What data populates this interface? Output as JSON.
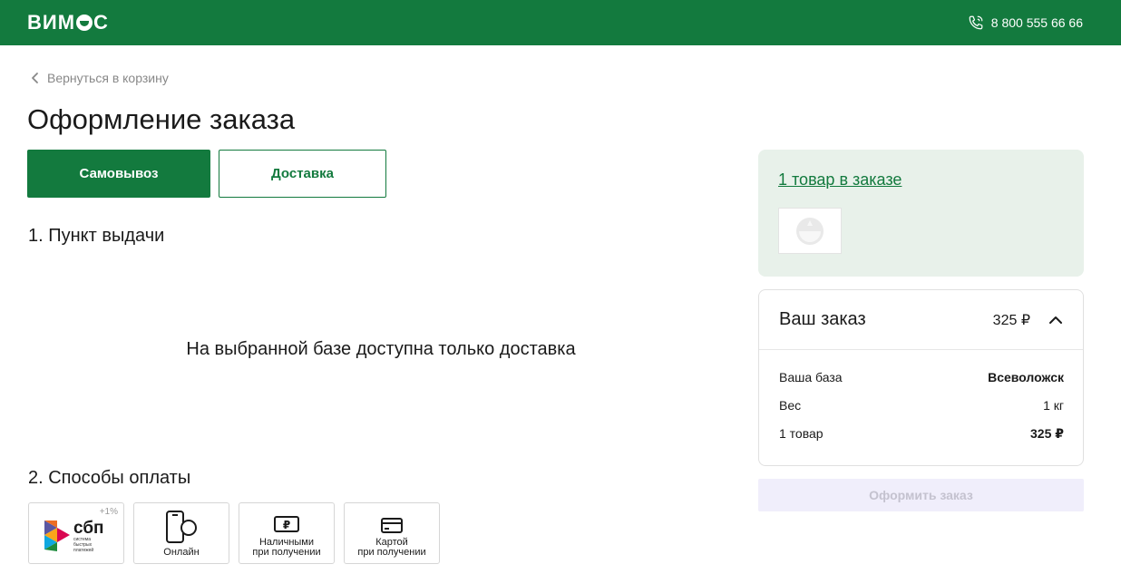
{
  "header": {
    "logo_left": "ВИМ",
    "logo_right": "С",
    "phone": "8 800 555 66 66"
  },
  "back_link": "Вернуться в корзину",
  "page_title": "Оформление заказа",
  "delivery_tabs": {
    "pickup": "Самовывоз",
    "delivery": "Доставка"
  },
  "sections": {
    "pickup_point": "1. Пункт выдачи",
    "payment_methods": "2. Способы оплаты"
  },
  "notice": "На выбранной базе доступна только доставка",
  "payments": {
    "sbp": {
      "logo": "сбп",
      "caption": "система быстрых платежей",
      "bonus": "+1%"
    },
    "online": {
      "label": "Онлайн"
    },
    "cash": {
      "line1": "Наличными",
      "line2": "при получении"
    },
    "card": {
      "line1": "Картой",
      "line2": "при получении"
    }
  },
  "cart": {
    "link": "1 товар в заказе"
  },
  "order": {
    "title": "Ваш заказ",
    "total": "325 ₽",
    "rows": [
      {
        "label": "Ваша база",
        "value": "Всеволожск"
      },
      {
        "label": "Вес",
        "value": "1 кг"
      },
      {
        "label": "1 товар",
        "value": "325 ₽"
      }
    ]
  },
  "submit_label": "Оформить заказ",
  "colors": {
    "brand_green": "#137a3e",
    "cart_bg": "#e8f1ea",
    "submit_disabled_bg": "#f0eefb"
  }
}
